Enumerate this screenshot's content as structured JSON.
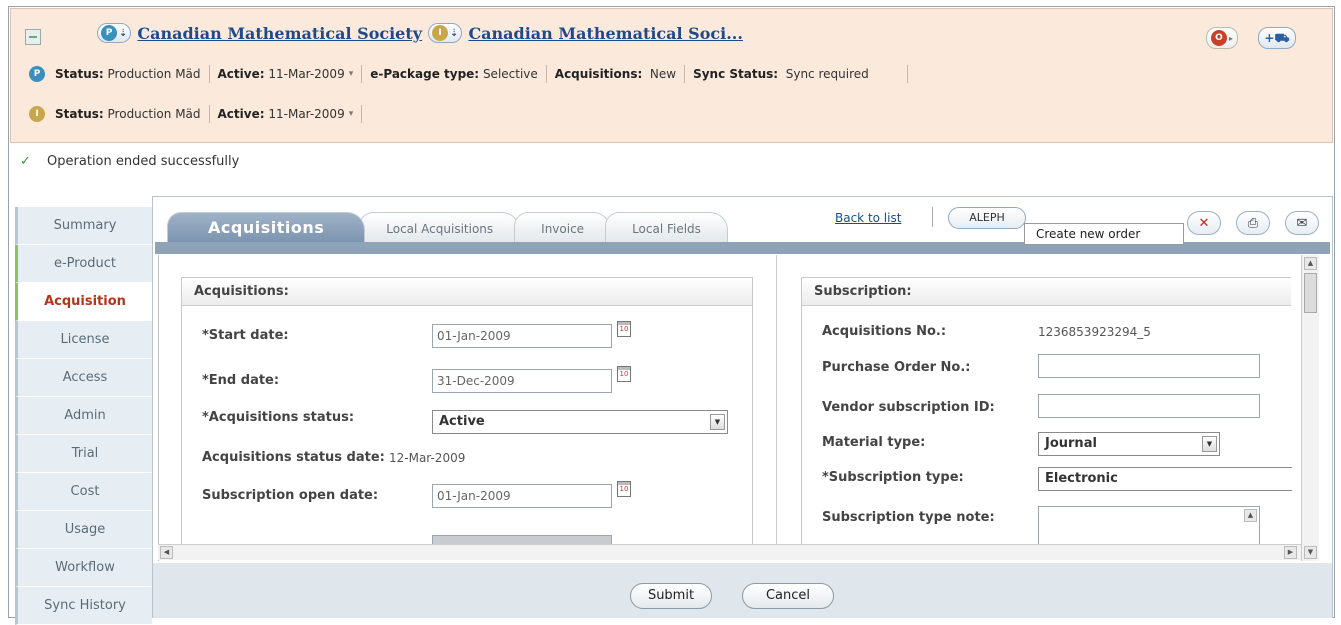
{
  "header": {
    "title_package": "Canadian Mathematical Society",
    "title_interface": "Canadian Mathematical Soci...",
    "package_icon": "P",
    "interface_icon": "I",
    "order_icon": "O",
    "cart_icon": "cart-add-icon",
    "package_status": {
      "status_label": "Status:",
      "status_value": "Production Mäd",
      "active_label": "Active:",
      "active_value": "11-Mar-2009",
      "epackage_label": "e-Package type:",
      "epackage_value": "Selective",
      "acq_label": "Acquisitions:",
      "acq_value": "New",
      "sync_label": "Sync Status:",
      "sync_value": "Sync required"
    },
    "interface_status": {
      "status_label": "Status:",
      "status_value": "Production Mäd",
      "active_label": "Active:",
      "active_value": "11-Mar-2009"
    }
  },
  "message": "Operation ended successfully",
  "sidenav": {
    "items": [
      "Summary",
      "e-Product",
      "Acquisition",
      "License",
      "Access",
      "Admin",
      "Trial",
      "Cost",
      "Usage",
      "Workflow",
      "Sync History"
    ],
    "active": "Acquisition"
  },
  "tabs": {
    "active": "Acquisitions",
    "local_acq": "Local Acquisitions",
    "invoice": "Invoice",
    "local_fields": "Local Fields"
  },
  "toolbar": {
    "back_link": "Back to list",
    "aleph": "ALEPH",
    "tooltip": "Create new order"
  },
  "acquisitions": {
    "heading": "Acquisitions:",
    "start_date_label": "*Start date:",
    "start_date": "01-Jan-2009",
    "end_date_label": "*End date:",
    "end_date": "31-Dec-2009",
    "status_label": "*Acquisitions status:",
    "status_value": "Active",
    "status_date_label": "Acquisitions status date:",
    "status_date": "12-Mar-2009",
    "sub_open_label": "Subscription open date:",
    "sub_open_date": "01-Jan-2009"
  },
  "subscription": {
    "heading": "Subscription:",
    "acq_no_label": "Acquisitions No.:",
    "acq_no": "1236853923294_5",
    "po_label": "Purchase Order No.:",
    "po_value": "",
    "vendor_label": "Vendor subscription ID:",
    "vendor_value": "",
    "material_label": "Material type:",
    "material_value": "Journal",
    "sub_type_label": "*Subscription type:",
    "sub_type_value": "Electronic",
    "sub_note_label": "Subscription type note:"
  },
  "buttons": {
    "submit": "Submit",
    "cancel": "Cancel"
  },
  "colors": {
    "header_bg": "#fbe9dc",
    "active_nav_text": "#b2361c",
    "tab_active": "#7d95b0",
    "link": "#1e4a8c"
  }
}
